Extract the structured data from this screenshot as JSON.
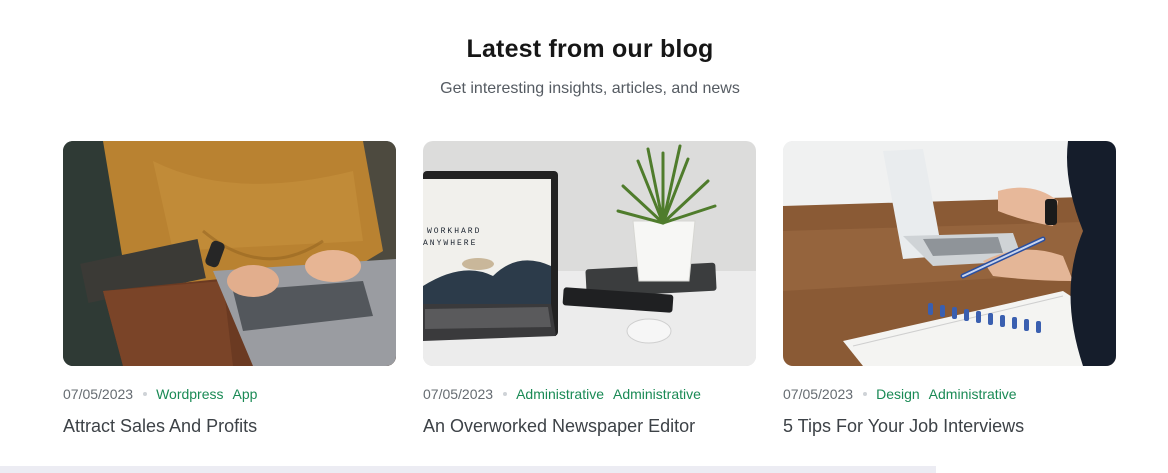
{
  "blog": {
    "heading": "Latest from our blog",
    "subheading": "Get interesting insights, articles, and news"
  },
  "posts": [
    {
      "date": "07/05/2023",
      "tags": [
        "Wordpress",
        "App"
      ],
      "title": "Attract Sales And Profits",
      "image": "person-typing-on-laptop-photo"
    },
    {
      "date": "07/05/2023",
      "tags": [
        "Administrative",
        "Administrative"
      ],
      "title": "An Overworked Newspaper Editor",
      "image": "laptop-and-plant-photo",
      "screen_text": [
        "WORKHARD",
        "ANYWHERE"
      ]
    },
    {
      "date": "07/05/2023",
      "tags": [
        "Design",
        "Administrative"
      ],
      "title": "5 Tips For Your Job Interviews",
      "image": "desk-notebook-photo"
    }
  ],
  "colors": {
    "tag": "#1a8a55",
    "heading": "#161616",
    "title": "#3d4247"
  }
}
